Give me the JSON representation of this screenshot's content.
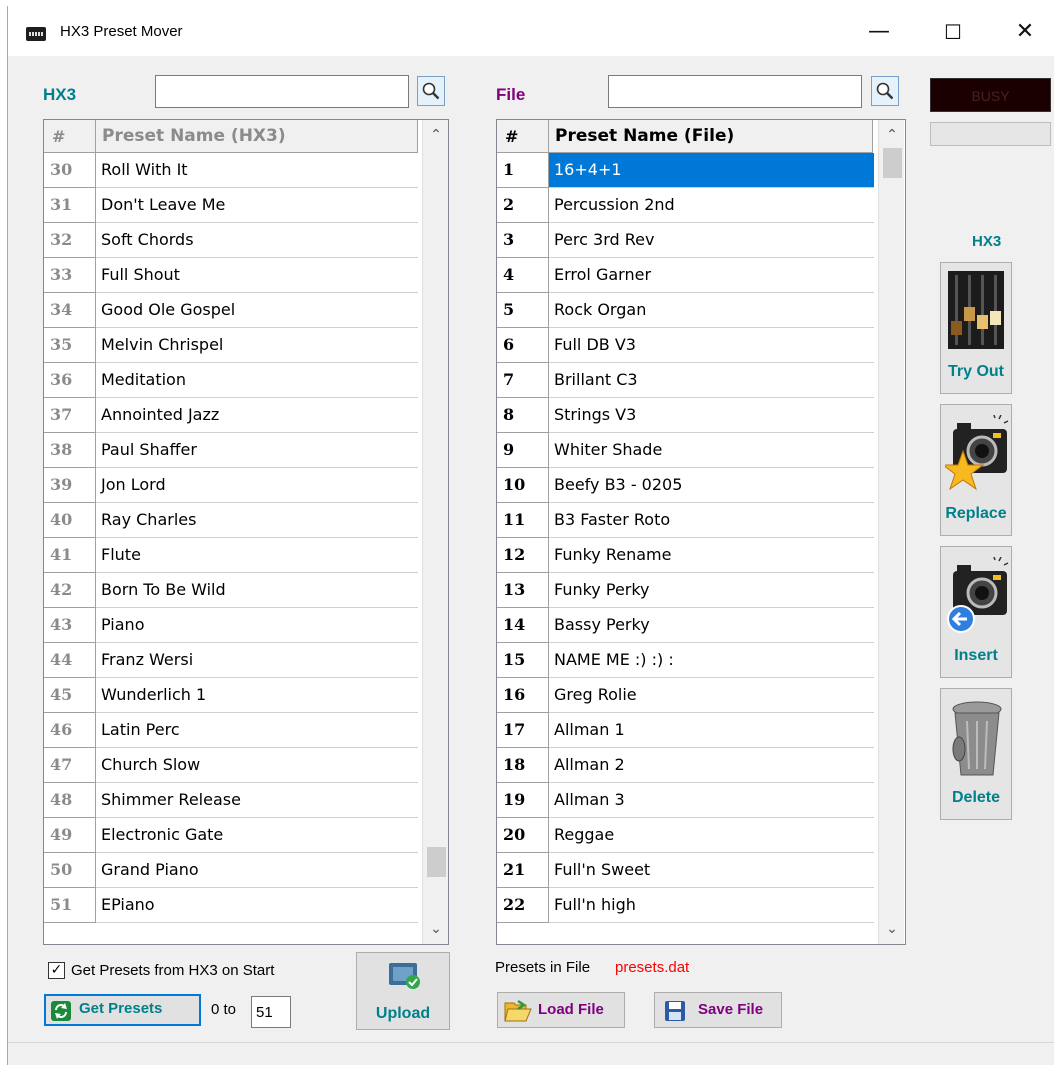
{
  "window": {
    "title": "HX3 Preset Mover",
    "minimize": "—",
    "maximize": "☐",
    "close": "✕"
  },
  "hx3_panel": {
    "label": "HX3",
    "search_value": "",
    "header_num": "#",
    "header_name": "Preset Name (HX3)",
    "rows": [
      {
        "num": "30",
        "name": "Roll With It"
      },
      {
        "num": "31",
        "name": "Don't Leave Me"
      },
      {
        "num": "32",
        "name": "Soft Chords"
      },
      {
        "num": "33",
        "name": "Full Shout"
      },
      {
        "num": "34",
        "name": "Good Ole Gospel"
      },
      {
        "num": "35",
        "name": "Melvin Chrispel"
      },
      {
        "num": "36",
        "name": "Meditation"
      },
      {
        "num": "37",
        "name": "Annointed Jazz"
      },
      {
        "num": "38",
        "name": "Paul Shaffer"
      },
      {
        "num": "39",
        "name": "Jon Lord"
      },
      {
        "num": "40",
        "name": "Ray Charles"
      },
      {
        "num": "41",
        "name": "Flute"
      },
      {
        "num": "42",
        "name": "Born To Be Wild"
      },
      {
        "num": "43",
        "name": "Piano"
      },
      {
        "num": "44",
        "name": "Franz Wersi"
      },
      {
        "num": "45",
        "name": "Wunderlich 1"
      },
      {
        "num": "46",
        "name": "Latin Perc"
      },
      {
        "num": "47",
        "name": "Church Slow"
      },
      {
        "num": "48",
        "name": "Shimmer Release"
      },
      {
        "num": "49",
        "name": "Electronic Gate"
      },
      {
        "num": "50",
        "name": "Grand Piano"
      },
      {
        "num": "51",
        "name": "EPiano"
      }
    ],
    "scroll_position": 0.95,
    "get_on_start_label": "Get Presets from HX3 on Start",
    "get_on_start_checked": true,
    "checkbox_mark": "✓",
    "get_presets_label": "Get Presets",
    "range_label": "0 to",
    "range_value": "51",
    "upload_label": "Upload"
  },
  "file_panel": {
    "label": "File",
    "search_value": "",
    "header_num": "#",
    "header_name": "Preset Name (File)",
    "selected_index": 0,
    "rows": [
      {
        "num": "1",
        "name": "16+4+1"
      },
      {
        "num": "2",
        "name": "Percussion 2nd"
      },
      {
        "num": "3",
        "name": "Perc 3rd Rev"
      },
      {
        "num": "4",
        "name": "Errol Garner"
      },
      {
        "num": "5",
        "name": "Rock Organ"
      },
      {
        "num": "6",
        "name": "Full DB V3"
      },
      {
        "num": "7",
        "name": "Brillant C3"
      },
      {
        "num": "8",
        "name": "Strings V3"
      },
      {
        "num": "9",
        "name": "Whiter Shade"
      },
      {
        "num": "10",
        "name": "Beefy B3 - 0205"
      },
      {
        "num": "11",
        "name": "B3 Faster Roto"
      },
      {
        "num": "12",
        "name": "Funky Rename"
      },
      {
        "num": "13",
        "name": "Funky Perky"
      },
      {
        "num": "14",
        "name": "Bassy Perky"
      },
      {
        "num": "15",
        "name": "NAME ME :) :) :"
      },
      {
        "num": "16",
        "name": "Greg Rolie"
      },
      {
        "num": "17",
        "name": "Allman 1"
      },
      {
        "num": "18",
        "name": "Allman 2"
      },
      {
        "num": "19",
        "name": "Allman 3"
      },
      {
        "num": "20",
        "name": "Reggae"
      },
      {
        "num": "21",
        "name": "Full'n Sweet"
      },
      {
        "num": "22",
        "name": "Full'n high"
      }
    ],
    "scroll_position": 0.0,
    "presets_in_file_label": "Presets in File",
    "file_name": "presets.dat",
    "load_label": "Load File",
    "save_label": "Save File"
  },
  "side": {
    "busy_label": "BUSY",
    "hx3_label": "HX3",
    "try_out_label": "Try Out",
    "replace_label": "Replace",
    "insert_label": "Insert",
    "delete_label": "Delete"
  },
  "colors": {
    "teal": "#00808a",
    "purple": "#800080",
    "selection": "#0078d7",
    "file_name": "#ff0000"
  }
}
